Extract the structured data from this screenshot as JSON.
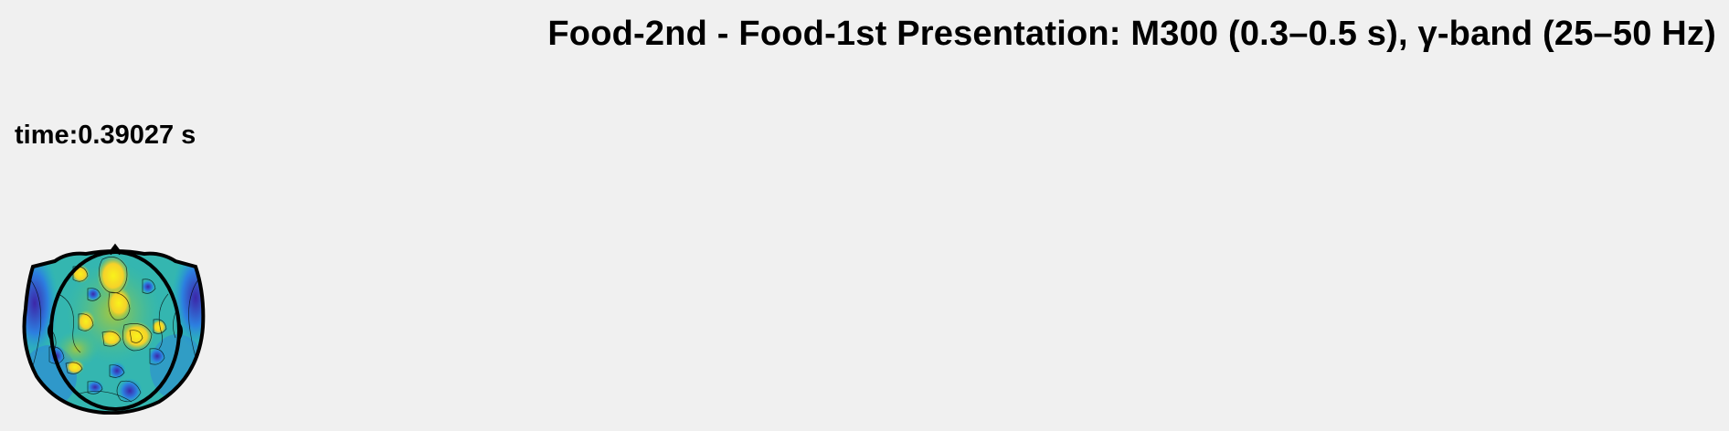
{
  "figure": {
    "title": "Food-2nd - Food-1st Presentation: M300 (0.3–0.5 s), γ-band (25–50 Hz)",
    "time_label": "time:0.39027 s",
    "background": "#f0f0f0"
  },
  "topoplot": {
    "icon": "head-topography-map",
    "colormap": "parula",
    "colors": {
      "dark_blue": "#3d26a8",
      "blue": "#2c7fe0",
      "cyan": "#1fb0cc",
      "teal_green": "#48c28a",
      "light_green": "#a8c83c",
      "yellow": "#f5d12a",
      "bright_yellow": "#f9f21a",
      "outline": "#000000"
    }
  }
}
